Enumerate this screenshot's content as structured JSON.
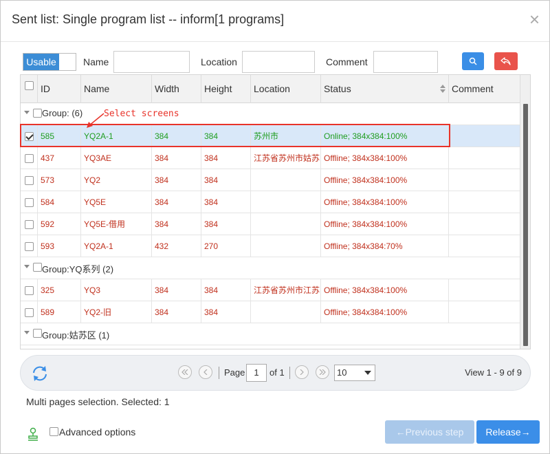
{
  "dialog": {
    "title": "Sent list: Single program list -- inform[1 programs]",
    "close_glyph": "×"
  },
  "toolbar": {
    "usable_label": "Usable",
    "name_label": "Name",
    "name_value": "",
    "location_label": "Location",
    "location_value": "",
    "comment_label": "Comment",
    "comment_value": "",
    "search_icon": "search-icon",
    "reset_icon": "undo-icon",
    "colors": {
      "search": "#3a8ee6",
      "reset": "#e9534b",
      "usable": "#3c8dd6"
    }
  },
  "grid": {
    "columns": [
      "ID",
      "Name",
      "Width",
      "Height",
      "Location",
      "Status",
      "Comment"
    ],
    "groups": [
      {
        "label": "Group: (6)",
        "rows": [
          {
            "id": "585",
            "name": "YQ2A-1",
            "width": "384",
            "height": "384",
            "location": "苏州市",
            "status": "Online; 384x384:100%",
            "checked": true,
            "state": "online"
          },
          {
            "id": "437",
            "name": "YQ3AE",
            "width": "384",
            "height": "384",
            "location": "江苏省苏州市姑苏",
            "status": "Offline; 384x384:100%",
            "checked": false,
            "state": "offline"
          },
          {
            "id": "573",
            "name": "YQ2",
            "width": "384",
            "height": "384",
            "location": "",
            "status": "Offline; 384x384:100%",
            "checked": false,
            "state": "offline"
          },
          {
            "id": "584",
            "name": "YQ5E",
            "width": "384",
            "height": "384",
            "location": "",
            "status": "Offline; 384x384:100%",
            "checked": false,
            "state": "offline"
          },
          {
            "id": "592",
            "name": "YQ5E-借用",
            "width": "384",
            "height": "384",
            "location": "",
            "status": "Offline; 384x384:100%",
            "checked": false,
            "state": "offline"
          },
          {
            "id": "593",
            "name": "YQ2A-1",
            "width": "432",
            "height": "270",
            "location": "",
            "status": "Offline; 384x384:70%",
            "checked": false,
            "state": "offline"
          }
        ]
      },
      {
        "label": "Group:YQ系列 (2)",
        "rows": [
          {
            "id": "325",
            "name": "YQ3",
            "width": "384",
            "height": "384",
            "location": "江苏省苏州市江苏",
            "status": "Offline; 384x384:100%",
            "checked": false,
            "state": "offline"
          },
          {
            "id": "589",
            "name": "YQ2-旧",
            "width": "384",
            "height": "384",
            "location": "",
            "status": "Offline; 384x384:100%",
            "checked": false,
            "state": "offline"
          }
        ]
      },
      {
        "label": "Group:姑苏区 (1)",
        "rows": []
      }
    ],
    "colors": {
      "online": "#1f9d1f",
      "offline": "#c0301d",
      "selected_row": "#d9e8f9"
    }
  },
  "annotation": {
    "text": "Select screens",
    "color": "#e8332a"
  },
  "pager": {
    "page_label": "Page",
    "page_value": "1",
    "of_label": "of 1",
    "page_size": "10",
    "view_text": "View 1 - 9 of 9"
  },
  "footer": {
    "selection_text": "Multi pages selection. Selected: 1",
    "advanced_label": "Advanced options",
    "prev_label": "←Previous step",
    "release_label": "Release→"
  }
}
